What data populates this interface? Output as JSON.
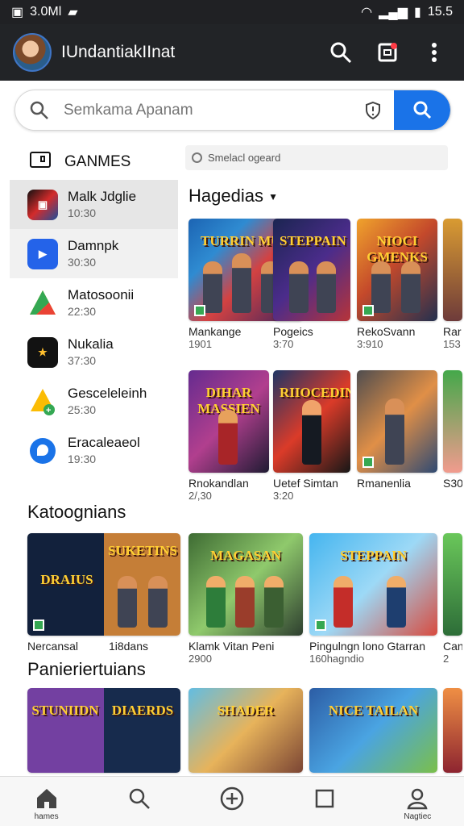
{
  "status": {
    "time_left": "3.0Ml",
    "time_right": "15.5"
  },
  "app": {
    "title": "IUndantiakIInat"
  },
  "search": {
    "placeholder": "Semkama Apanam"
  },
  "sidebar": {
    "heading": "GANMES",
    "items": [
      {
        "name": "Malk Jdglie",
        "time": "10:30"
      },
      {
        "name": "Damnpk",
        "time": "30:30"
      },
      {
        "name": "Matosoonii",
        "time": "22:30"
      },
      {
        "name": "Nukalia",
        "time": "37:30"
      },
      {
        "name": "Gesceleleinh",
        "time": "25:30"
      },
      {
        "name": "Eracaleaeol",
        "time": "19:30"
      }
    ]
  },
  "content": {
    "chip": "Smelacl ogeard",
    "section1": "Hagedias",
    "section2": "Katoognians",
    "section3": "Panieriertuians",
    "row1": [
      {
        "name": "Mankange",
        "meta": "1901",
        "art": "TURRIN MUN"
      },
      {
        "name": "Pogeics",
        "meta": "3:70",
        "art": "STEPPAIN"
      },
      {
        "name": "RekoSvann",
        "meta": "3:910",
        "art": "NIOCI GMENKS"
      },
      {
        "name": "Rar",
        "meta": "153",
        "art": ""
      }
    ],
    "row2": [
      {
        "name": "Rnokandlan",
        "meta": "2/,30",
        "art": "DIHAR MASSIEN"
      },
      {
        "name": "Uetef Simtan",
        "meta": "3:20",
        "art": "RIIOCEDIN"
      },
      {
        "name": "Rmanenlia",
        "meta": "",
        "art": ""
      },
      {
        "name": "S30",
        "meta": "",
        "art": ""
      }
    ],
    "row3": [
      {
        "name": "Nercansal",
        "meta": "",
        "art": "DRAIUS"
      },
      {
        "name": "1i8dans",
        "meta": "",
        "art": "SUKETINS"
      },
      {
        "name": "Klamk Vitan Peni",
        "meta": "2900",
        "art": "MAGASAN"
      },
      {
        "name": "Pingulngn lono Gtarran",
        "meta": "160hagndio",
        "art": "STEPPAIN"
      },
      {
        "name": "Can",
        "meta": "2",
        "art": ""
      }
    ],
    "row4": [
      {
        "name": "",
        "meta": "",
        "art": "STUNIIDN"
      },
      {
        "name": "",
        "meta": "",
        "art": "DIAERDS"
      },
      {
        "name": "",
        "meta": "",
        "art": "SHADER"
      },
      {
        "name": "",
        "meta": "",
        "art": "NICE TAILAN"
      }
    ]
  },
  "nav": {
    "home": "hames",
    "profile": "Nagtiec"
  }
}
